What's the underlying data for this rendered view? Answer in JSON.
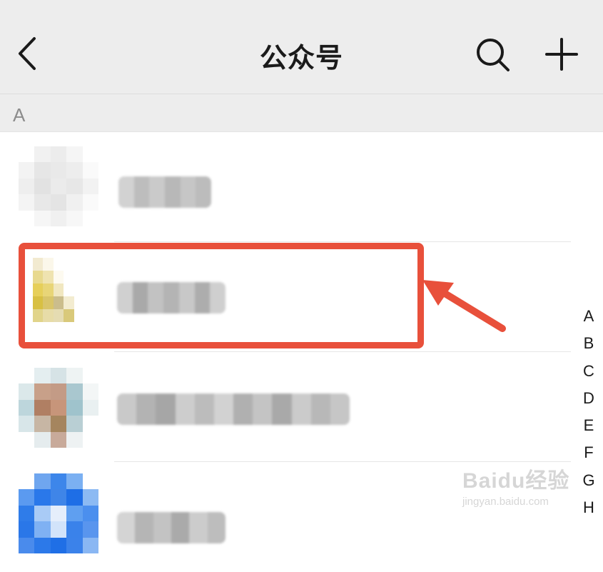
{
  "nav": {
    "title": "公众号",
    "back_icon": "chevron-left-icon",
    "search_icon": "search-icon",
    "add_icon": "plus-icon"
  },
  "section": {
    "letter": "A"
  },
  "accounts": [
    {
      "name": "",
      "avatar": "blurred-avatar",
      "highlighted": false
    },
    {
      "name": "",
      "avatar": "blurred-avatar",
      "highlighted": true
    },
    {
      "name": "",
      "avatar": "blurred-avatar",
      "highlighted": false
    },
    {
      "name": "",
      "avatar": "blurred-avatar",
      "highlighted": false
    }
  ],
  "index_letters": [
    "A",
    "B",
    "C",
    "D",
    "E",
    "F",
    "G",
    "H"
  ],
  "annotation": {
    "box_color": "#e8503b",
    "arrow_color": "#e8503b"
  },
  "watermark": {
    "main": "Baidu经验",
    "sub": "jingyan.baidu.com"
  },
  "colors": {
    "nav_background": "#ededed",
    "text_primary": "#1a1a1a",
    "text_secondary": "#8c8c8c"
  }
}
